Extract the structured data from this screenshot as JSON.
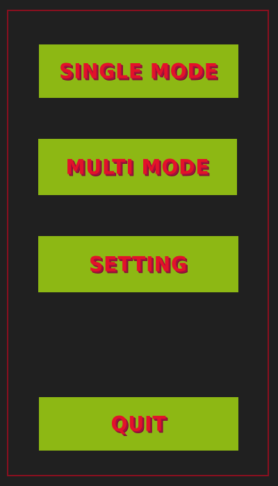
{
  "menu": {
    "single_mode_label": "SINGLE MODE",
    "multi_mode_label": "MULTI MODE",
    "setting_label": "SETTING",
    "quit_label": "QUIT"
  },
  "colors": {
    "background": "#202020",
    "frame_border": "#8b0f1f",
    "button_fill": "#8db814",
    "button_text": "#e3122a"
  }
}
